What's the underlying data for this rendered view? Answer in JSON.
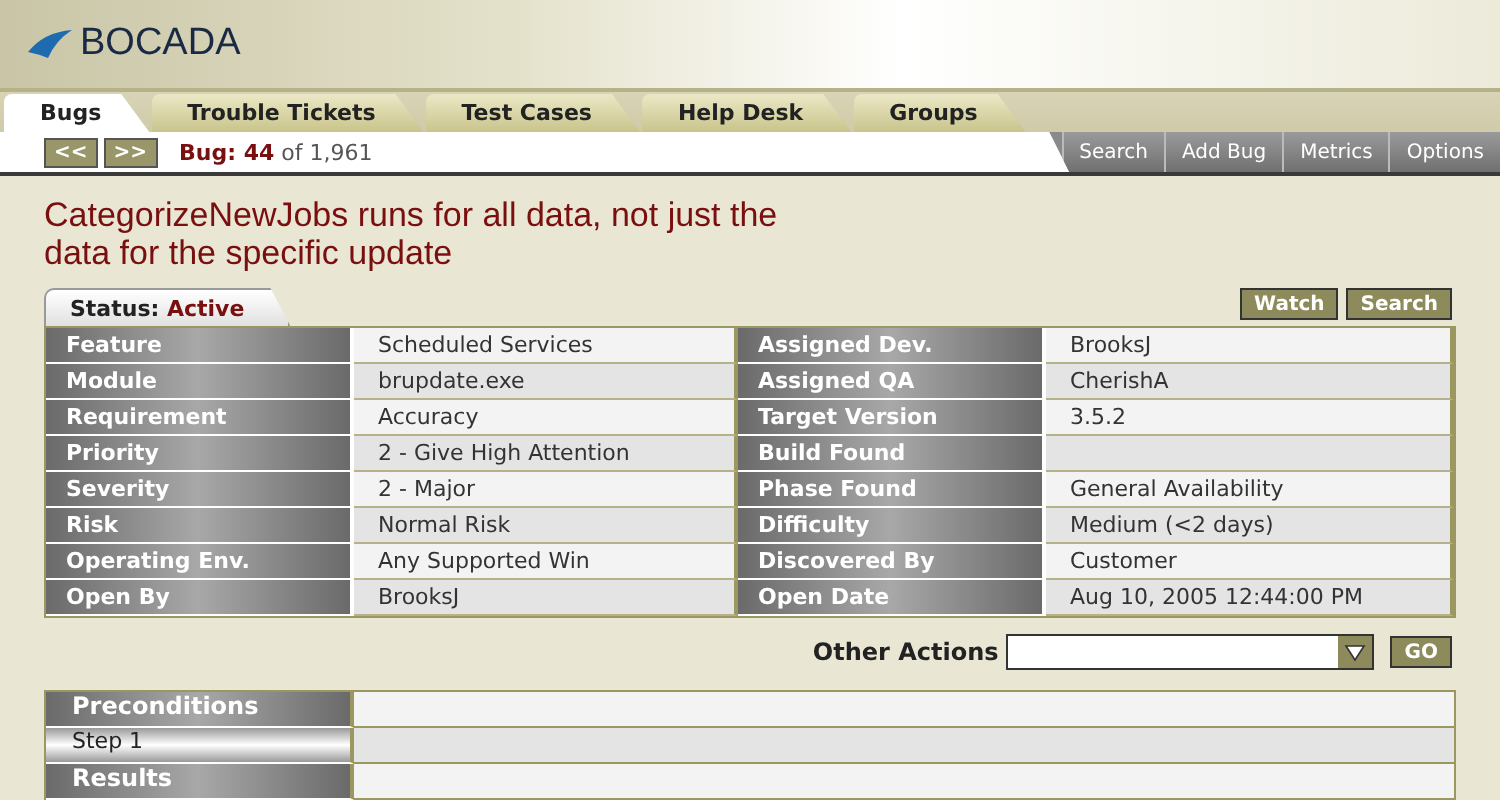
{
  "logo": {
    "text": "BOCADA"
  },
  "tabs": [
    {
      "label": "Bugs",
      "selected": true
    },
    {
      "label": "Trouble Tickets",
      "selected": false
    },
    {
      "label": "Test Cases",
      "selected": false
    },
    {
      "label": "Help Desk",
      "selected": false
    },
    {
      "label": "Groups",
      "selected": false
    }
  ],
  "nav": {
    "prev": "<<",
    "next": ">>",
    "counter": "**Bug: 44** of 1,961"
  },
  "toolbar": [
    "Search",
    "Add Bug",
    "Metrics",
    "Options"
  ],
  "bug_title": "CategorizeNewJobs runs for all data, not just the data for the specific update",
  "status": {
    "label": "Status:",
    "value": "Active"
  },
  "actions": [
    "Watch",
    "Search"
  ],
  "details": [
    {
      "left": {
        "label": "Feature",
        "value": "Scheduled Services"
      },
      "right": {
        "label": "Assigned Dev.",
        "value": "BrooksJ"
      }
    },
    {
      "left": {
        "label": "Module",
        "value": "brupdate.exe"
      },
      "right": {
        "label": "Assigned QA",
        "value": "CherishA"
      }
    },
    {
      "left": {
        "label": "Requirement",
        "value": "Accuracy"
      },
      "right": {
        "label": "Target Version",
        "value": "3.5.2"
      }
    },
    {
      "left": {
        "label": "Priority",
        "value": "2 - Give High Attention"
      },
      "right": {
        "label": "Build Found"
      }
    },
    {
      "left": {
        "label": "Severity",
        "value": "2 - Major"
      },
      "right": {
        "label": "Phase Found",
        "value": "General Availability"
      }
    },
    {
      "left": {
        "label": "Risk",
        "value": "Normal Risk"
      },
      "right": {
        "label": "Difficulty",
        "value": "Medium (<2 days)"
      }
    },
    {
      "left": {
        "label": "Operating Env.",
        "value": "Any Supported Win"
      },
      "right": {
        "label": "Discovered By",
        "value": "Customer"
      }
    },
    {
      "left": {
        "label": "Open By",
        "value": "BrooksJ"
      },
      "right": {
        "label": "Open Date",
        "value": "Aug 10, 2005 12:44:00 PM"
      }
    }
  ],
  "other_actions": {
    "label": "Other Actions",
    "go": "GO"
  },
  "steps": [
    {
      "kind": "section",
      "label": "Preconditions"
    },
    {
      "kind": "step",
      "label": "Step 1"
    },
    {
      "kind": "section",
      "label": "Results"
    }
  ]
}
